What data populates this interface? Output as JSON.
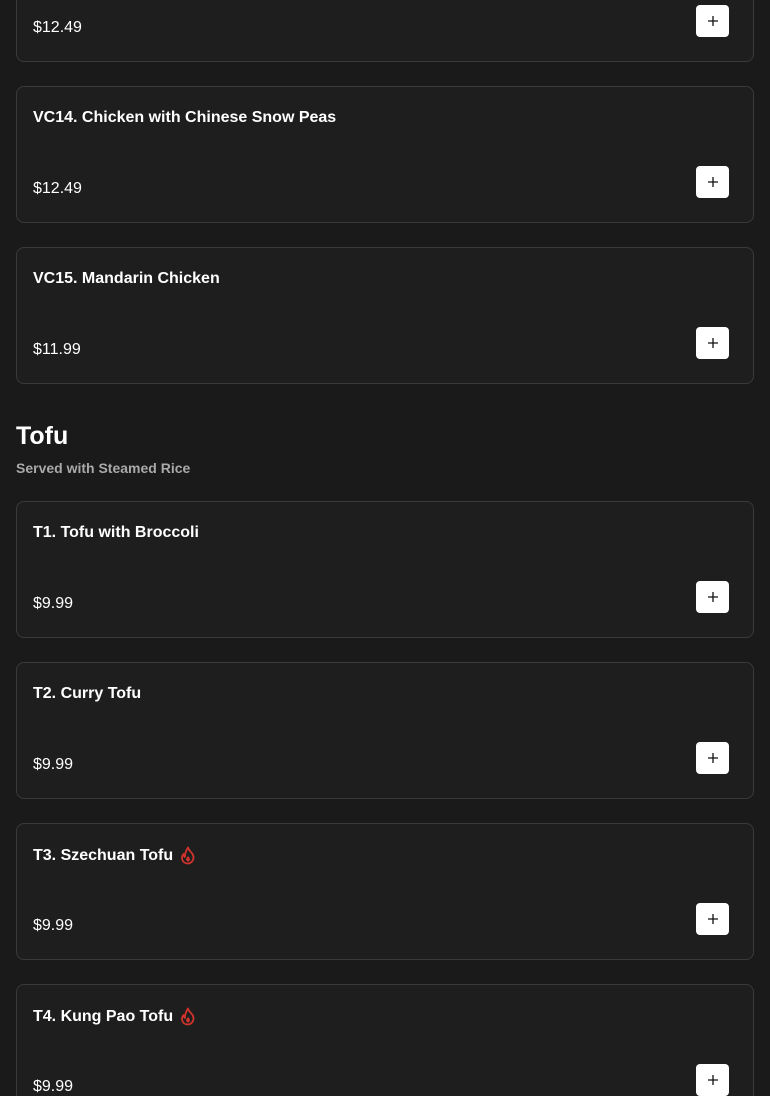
{
  "add_icon": "plus-icon",
  "spicy_icon": "flame-icon",
  "colors": {
    "background": "#1a1a1a",
    "card_background": "#1e1e1e",
    "card_border": "#3a3a3a",
    "button_background": "#ffffff",
    "spicy": "#d0342c",
    "subtitle": "#a9a9a9"
  },
  "previous_items": [
    {
      "name": "",
      "price": "$12.49",
      "spicy": false
    },
    {
      "name": "VC14. Chicken with Chinese Snow Peas",
      "price": "$12.49",
      "spicy": false
    },
    {
      "name": "VC15. Mandarin Chicken",
      "price": "$11.99",
      "spicy": false
    }
  ],
  "tofu_section": {
    "title": "Tofu",
    "subtitle": "Served with Steamed Rice",
    "items": [
      {
        "name": "T1. Tofu with Broccoli",
        "price": "$9.99",
        "spicy": false
      },
      {
        "name": "T2. Curry Tofu",
        "price": "$9.99",
        "spicy": false
      },
      {
        "name": "T3. Szechuan Tofu",
        "price": "$9.99",
        "spicy": true
      },
      {
        "name": "T4. Kung Pao Tofu",
        "price": "$9.99",
        "spicy": true
      }
    ]
  }
}
